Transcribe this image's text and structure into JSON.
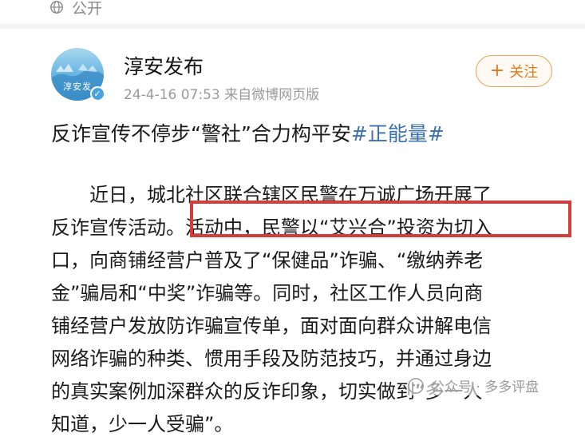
{
  "visibility": {
    "icon": "globe-icon",
    "label": "公开"
  },
  "post": {
    "author": "淳安发布",
    "avatar_text": "淳安发",
    "timestamp": "24-4-16 07:53",
    "source": "来自微博网页版",
    "follow_label": "关注",
    "headline_text": "反诈宣传不停步“警社”合力构平安",
    "hashtag": "#正能量#",
    "body_lines": [
      "近日，城北社区联合辖区民警在万诚广场开展了",
      "反诈宣传活动。活动中，民警以“艾兴合”投资为切入",
      "口，向商铺经营户普及了“保健品”诈骗、“缴纳养老",
      "金”骗局和“中奖”诈骗等。同时，社区工作人员向商",
      "铺经营户发放防诈骗宣传单，面对面向群众讲解电信",
      "网络诈骗的种类、惯用手段及防范技巧，并通过身边",
      "的真实案例加深群众的反诈印象，切实做到“多一人",
      "知道，少一人受骗”。"
    ]
  },
  "watermark": {
    "text": "公众号 · 多多评盘"
  },
  "colors": {
    "accent_orange": "#e07b1a",
    "highlight_red": "#d93a3a",
    "hashtag_blue": "#3b6fb6"
  }
}
